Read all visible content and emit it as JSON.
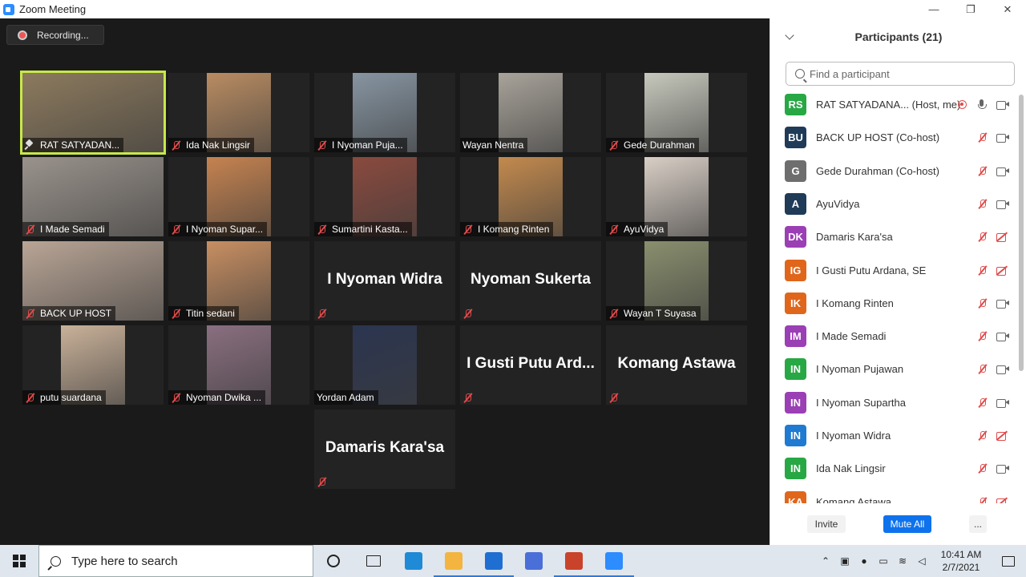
{
  "window": {
    "title": "Zoom Meeting",
    "minimize": "—",
    "restore": "❐",
    "close": "✕"
  },
  "recording": {
    "label": "Recording..."
  },
  "tiles": [
    {
      "label": "RAT SATYADAN...",
      "active": true,
      "icon": "pin",
      "photo_color": "#8c7a5e"
    },
    {
      "label": "Ida Nak Lingsir",
      "icon": "mic-off",
      "photo_color": "#b98c62"
    },
    {
      "label": "I Nyoman Puja...",
      "icon": "mic-off",
      "photo_color": "#8795a2"
    },
    {
      "label": "Wayan Nentra",
      "icon": "none",
      "photo_color": "#a8a39a"
    },
    {
      "label": "Gede Durahman",
      "icon": "mic-off",
      "photo_color": "#c7c9bd"
    },
    {
      "label": "I Made Semadi",
      "icon": "mic-off",
      "photo_color": "#9a938c"
    },
    {
      "label": "I Nyoman Supar...",
      "icon": "mic-off",
      "photo_color": "#c68350"
    },
    {
      "label": "Sumartini Kasta...",
      "icon": "mic-off",
      "photo_color": "#8a4a3e"
    },
    {
      "label": "I Komang Rinten",
      "icon": "mic-off",
      "photo_color": "#c38a4e"
    },
    {
      "label": "AyuVidya",
      "icon": "mic-off",
      "photo_color": "#d9cfc6"
    },
    {
      "label": "BACK UP HOST",
      "icon": "mic-off",
      "photo_color": "#b9a596"
    },
    {
      "label": "Titin sedani",
      "icon": "mic-off",
      "photo_color": "#c88f62"
    },
    {
      "label": "",
      "big_name": "I Nyoman Widra",
      "icon": "mic-off"
    },
    {
      "label": "",
      "big_name": "Nyoman Sukerta",
      "icon": "mic-off"
    },
    {
      "label": "Wayan T Suyasa",
      "icon": "mic-off",
      "photo_color": "#8a8f6e"
    },
    {
      "label": "putu suardana",
      "icon": "mic-off",
      "photo_color": "#c9b199"
    },
    {
      "label": "Nyoman Dwika ...",
      "icon": "mic-off",
      "photo_color": "#8a6f80"
    },
    {
      "label": "Yordan Adam",
      "icon": "none",
      "photo_color": "#2b3550"
    },
    {
      "label": "",
      "big_name": "I Gusti Putu Ard...",
      "icon": "mic-off"
    },
    {
      "label": "",
      "big_name": "Komang Astawa",
      "icon": "mic-off"
    },
    {
      "label": "",
      "big_name": "Damaris Kara'sa",
      "icon": "mic-off"
    }
  ],
  "participants_panel": {
    "title": "Participants (21)",
    "search_placeholder": "Find a participant",
    "participants": [
      {
        "initials": "RS",
        "name": "RAT SATYADANA... (Host, me)",
        "color": "#27a844",
        "recording": true,
        "mic": "on",
        "video": "on"
      },
      {
        "initials": "BU",
        "name": "BACK UP HOST (Co-host)",
        "color": "#1f3b57",
        "mic": "off",
        "video": "on"
      },
      {
        "initials": "G",
        "name": "Gede Durahman (Co-host)",
        "color": "#6e6e6e",
        "mic": "off",
        "video": "on"
      },
      {
        "initials": "A",
        "name": "AyuVidya",
        "color": "#1f3b57",
        "mic": "off",
        "video": "on"
      },
      {
        "initials": "DK",
        "name": "Damaris Kara'sa",
        "color": "#9b3fb5",
        "mic": "off",
        "video": "off"
      },
      {
        "initials": "IG",
        "name": "I Gusti Putu Ardana, SE",
        "color": "#e0661c",
        "mic": "off",
        "video": "off"
      },
      {
        "initials": "IK",
        "name": "I Komang Rinten",
        "color": "#e0661c",
        "mic": "off",
        "video": "on"
      },
      {
        "initials": "IM",
        "name": "I Made Semadi",
        "color": "#9b3fb5",
        "mic": "off",
        "video": "on"
      },
      {
        "initials": "IN",
        "name": "I Nyoman Pujawan",
        "color": "#27a844",
        "mic": "off",
        "video": "on"
      },
      {
        "initials": "IN",
        "name": "I Nyoman Supartha",
        "color": "#9b3fb5",
        "mic": "off",
        "video": "on"
      },
      {
        "initials": "IN",
        "name": "I Nyoman Widra",
        "color": "#1f7ad1",
        "mic": "off",
        "video": "off"
      },
      {
        "initials": "IN",
        "name": "Ida Nak Lingsir",
        "color": "#27a844",
        "mic": "off",
        "video": "on"
      },
      {
        "initials": "KA",
        "name": "Komang Astawa",
        "color": "#e0661c",
        "mic": "off",
        "video": "off"
      }
    ],
    "buttons": {
      "invite": "Invite",
      "mute_all": "Mute All",
      "more": "..."
    }
  },
  "taskbar": {
    "search_placeholder": "Type here to search",
    "apps": [
      {
        "icon": "cortana-icon"
      },
      {
        "icon": "task-view-icon"
      },
      {
        "icon": "edge-icon",
        "color": "#1f8ad6"
      },
      {
        "icon": "file-explorer-icon",
        "color": "#f3b53f"
      },
      {
        "icon": "mail-icon",
        "color": "#1e6fd1"
      },
      {
        "icon": "notepad-icon",
        "color": "#4a6fd8"
      },
      {
        "icon": "powerpoint-icon",
        "color": "#c9432a"
      },
      {
        "icon": "zoom-icon",
        "color": "#2d8cff"
      }
    ],
    "time": "10:41 AM",
    "date": "2/7/2021"
  }
}
